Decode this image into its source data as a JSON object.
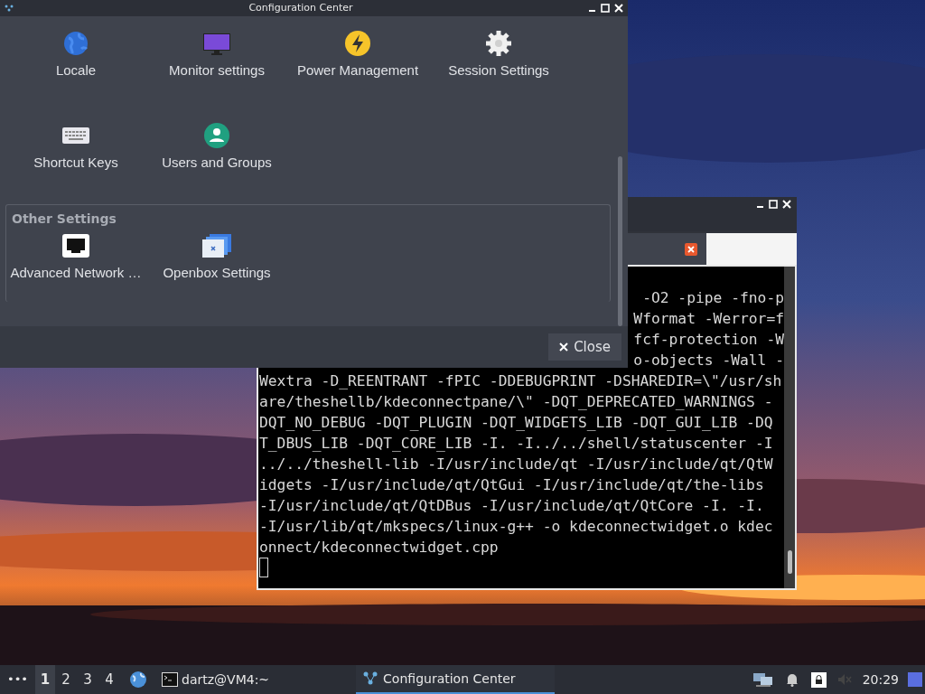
{
  "config_window": {
    "title": "Configuration Center",
    "sections": [
      {
        "items": [
          {
            "label": "Locale"
          },
          {
            "label": "Monitor settings"
          },
          {
            "label": "Power Management"
          },
          {
            "label": "Session Settings"
          },
          {
            "label": "Shortcut Keys"
          },
          {
            "label": "Users and Groups"
          }
        ]
      },
      {
        "title": "Other Settings",
        "items": [
          {
            "label": "Advanced Network …"
          },
          {
            "label": "Openbox Settings"
          }
        ]
      }
    ],
    "close_button": "Close"
  },
  "terminal": {
    "lines": [
      {
        "kind": "partial",
        "text": "-O2 -pipe -fno-p"
      },
      {
        "kind": "partial",
        "text": "Wformat -Werror=f"
      },
      {
        "kind": "partial",
        "text": "fcf-protection -W"
      },
      {
        "kind": "partial",
        "text": "o-objects -Wall -"
      },
      {
        "kind": "full",
        "text": "Wextra -D_REENTRANT -fPIC -DDEBUGPRINT -DSHAREDIR=\\\"/usr/sh"
      },
      {
        "kind": "full",
        "text": "are/theshellb/kdeconnectpane/\\\" -DQT_DEPRECATED_WARNINGS -"
      },
      {
        "kind": "full",
        "text": "DQT_NO_DEBUG -DQT_PLUGIN -DQT_WIDGETS_LIB -DQT_GUI_LIB -DQ"
      },
      {
        "kind": "full",
        "text": "T_DBUS_LIB -DQT_CORE_LIB -I. -I../../shell/statuscenter -I"
      },
      {
        "kind": "full",
        "text": "../../theshell-lib -I/usr/include/qt -I/usr/include/qt/QtW"
      },
      {
        "kind": "full",
        "text": "idgets -I/usr/include/qt/QtGui -I/usr/include/qt/the-libs"
      },
      {
        "kind": "full",
        "text": "-I/usr/include/qt/QtDBus -I/usr/include/qt/QtCore -I. -I."
      },
      {
        "kind": "full",
        "text": "-I/usr/lib/qt/mkspecs/linux-g++ -o kdeconnectwidget.o kdec"
      },
      {
        "kind": "full",
        "text": "onnect/kdeconnectwidget.cpp"
      }
    ]
  },
  "taskbar": {
    "menu": "•••",
    "workspaces": [
      {
        "label": "1",
        "selected": true
      },
      {
        "label": "2",
        "selected": false
      },
      {
        "label": "3",
        "selected": false
      },
      {
        "label": "4",
        "selected": false
      }
    ],
    "tasks": [
      {
        "label": "dartz@VM4:~",
        "active": false
      },
      {
        "label": "Configuration Center",
        "active": true
      }
    ],
    "clock": "20:29"
  }
}
